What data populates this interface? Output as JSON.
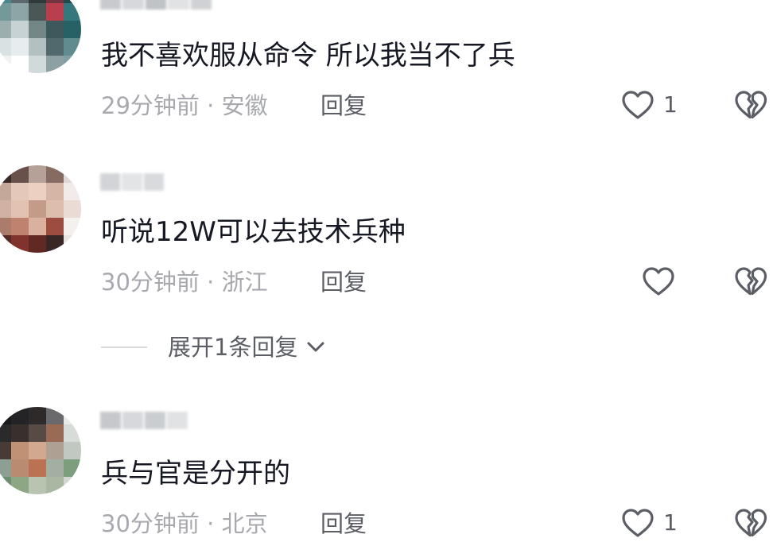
{
  "comments": [
    {
      "text": "我不喜欢服从命令 所以我当不了兵",
      "time": "29分钟前",
      "location": "安徽",
      "reply_label": "回复",
      "likes": "1",
      "avatar_colors": [
        "#3e8a8e",
        "#5a6a6e",
        "#2f3a3c",
        "#7a3440",
        "#1d4a4e",
        "#6e9a9a",
        "#8aa6a8",
        "#4a5658",
        "#c93a48",
        "#2a7a80",
        "#98b0b2",
        "#c4d2d4",
        "#70888a",
        "#3a5a5e",
        "#1f6268",
        "#d8e2e4",
        "#e6ecee",
        "#b0c0c2",
        "#4e6a6e",
        "#5a8e92",
        "#f0f2f2",
        "#ffffff",
        "#d0dadc",
        "#8aa2a4",
        "#7aa0a4"
      ],
      "username_colors": [
        "#c8cacd",
        "#d6d8db",
        "#bfc2c6",
        "#e0e2e4",
        "#cfd1d4"
      ]
    },
    {
      "text": "听说12W可以去技术兵种",
      "time": "30分钟前",
      "location": "浙江",
      "reply_label": "回复",
      "likes": "",
      "avatar_colors": [
        "#3a2a26",
        "#6a5048",
        "#b8a096",
        "#8a6a60",
        "#e0d8d4",
        "#c8a898",
        "#e8c8b6",
        "#f0d0be",
        "#d8b4a2",
        "#f2ece8",
        "#d4b0a0",
        "#e6c2ae",
        "#c89a84",
        "#e2bca8",
        "#ecdcd2",
        "#b27a66",
        "#c8806a",
        "#e0b09a",
        "#a84a3a",
        "#f4f0ee",
        "#5a2a22",
        "#8a3028",
        "#6a2620",
        "#3a2624",
        "#e8e4e2"
      ],
      "username_colors": [
        "#d2d4d7",
        "#e2e4e6",
        "#d8dadd"
      ]
    },
    {
      "text": "兵与官是分开的",
      "time": "30分钟前",
      "location": "北京",
      "reply_label": "回复",
      "likes": "1",
      "avatar_colors": [
        "#1a1a1c",
        "#242426",
        "#2e2a2a",
        "#6a6a6c",
        "#e8eae8",
        "#2a2a2c",
        "#3a302c",
        "#5a4a42",
        "#a06a50",
        "#d8dcd8",
        "#4a3a34",
        "#c89070",
        "#d8a888",
        "#b0a090",
        "#c0c8c0",
        "#8aa090",
        "#c08a6a",
        "#c4704a",
        "#a0b0a0",
        "#78a078",
        "#6a9070",
        "#8aa880",
        "#b8c4b0",
        "#a8b8a0",
        "#d0d8d0"
      ],
      "username_colors": [
        "#c6c8cb",
        "#d6d8db",
        "#cacdd0",
        "#e0e2e4"
      ]
    }
  ],
  "separator": "·",
  "expand": {
    "label": "展开1条回复"
  },
  "icons": {
    "like": "heart-outline-icon",
    "dislike": "broken-heart-icon",
    "expand": "chevron-down-icon"
  },
  "colors": {
    "text": "#161823",
    "meta": "#a7a9ae",
    "action": "#5c5e66"
  }
}
